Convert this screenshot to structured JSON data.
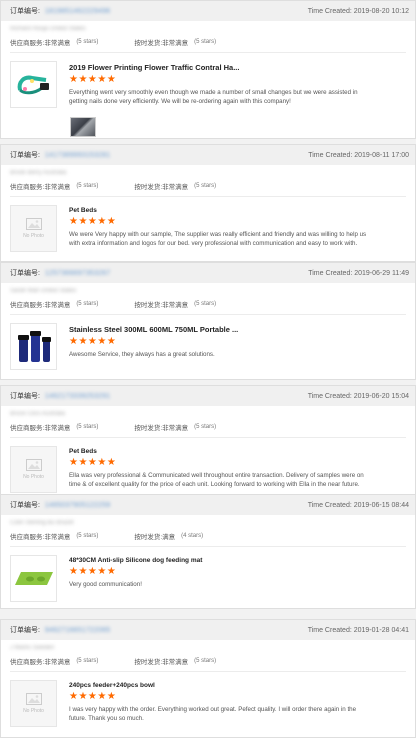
{
  "labels": {
    "order_no": "订单编号:",
    "time_prefix": "Time Created:",
    "service_rating": "供应商服务:",
    "shipping_rating": "按时发货:",
    "no_photo": "No Photo"
  },
  "colors": {
    "star": "#ff6a00",
    "header_bg": "#f0f0f0"
  },
  "orders": [
    {
      "order_no": "1819851462229496",
      "time": "Time Created: 2019-08-20 10:12",
      "buyer": "Richard Hooja United States",
      "service": "非常满意",
      "service_stars": "(5 stars)",
      "shipping": "非常满意",
      "shipping_stars": "(5 stars)",
      "product_title": "2019 Flower Printing Flower Traffic Contral Ha...",
      "rating": 5,
      "comment": "Everything went very smoothly even though we made a number of small changes but we were assisted in getting nails done very efficiently. We will be re-ordering again with this company!",
      "has_photo": true,
      "extra_photo": true
    },
    {
      "order_no": "1417389993153281",
      "time": "Time Created: 2019-08-11 17:00",
      "buyer": "Brook Berry Australia",
      "service": "非常满意",
      "service_stars": "(5 stars)",
      "shipping": "非常满意",
      "shipping_stars": "(5 stars)",
      "product_title": "Pet Beds",
      "rating": 5,
      "comment": "We were Very happy with our sample, The supplier was really efficient and friendly and was willing to help us with extra information and logos for our bed. very professional with communication and easy to work with.",
      "has_photo": false
    },
    {
      "order_no": "1257366697353267",
      "time": "Time Created: 2019-06-29 11:49",
      "buyer": "Sarah Mall United States",
      "service": "非常满意",
      "service_stars": "(5 stars)",
      "shipping": "非常满意",
      "shipping_stars": "(5 stars)",
      "product_title": "Stainless Steel 300ML 600ML 750ML Portable ...",
      "rating": 5,
      "comment": "Awesome Service, they always has a great solutions.",
      "has_photo": true
    },
    {
      "order_no": "1462173339253291",
      "time": "Time Created: 2019-06-20 15:04",
      "buyer": "Bruce Cliss Australia",
      "service": "非常满意",
      "service_stars": "(5 stars)",
      "shipping": "非常满意",
      "shipping_stars": "(5 stars)",
      "product_title": "Pet Beds",
      "rating": 5,
      "comment": "Ella was very professional & Communicated well throughout entire transaction. Delivery of samples were on time & of excellent quality for the price of each unit. Looking forward to working with Ella in the near future.",
      "has_photo": false
    },
    {
      "order_no": "1465037905122259",
      "time": "Time Created: 2019-06-15 08:44",
      "buyer": "Colin Sterling Bu Brazet",
      "service": "非常满意",
      "service_stars": "(5 stars)",
      "shipping": "满意",
      "shipping_stars": "(4 stars)",
      "product_title": "48*30CM Anti-slip Silicone dog feeding mat",
      "rating": 5,
      "comment": "Very good communication!",
      "has_photo": true
    },
    {
      "order_no": "9462716651722065",
      "time": "Time Created: 2019-01-28 04:41",
      "buyer": "J Marks Sweden",
      "service": "非常满意",
      "service_stars": "(5 stars)",
      "shipping": "非常满意",
      "shipping_stars": "(5 stars)",
      "product_title": "240pcs feeder+240pcs bowl",
      "rating": 5,
      "comment": "I was very happy with the order. Everything worked out great. Pefect quality. I will order there again in the future. Thank you so much.",
      "has_photo": false
    }
  ]
}
